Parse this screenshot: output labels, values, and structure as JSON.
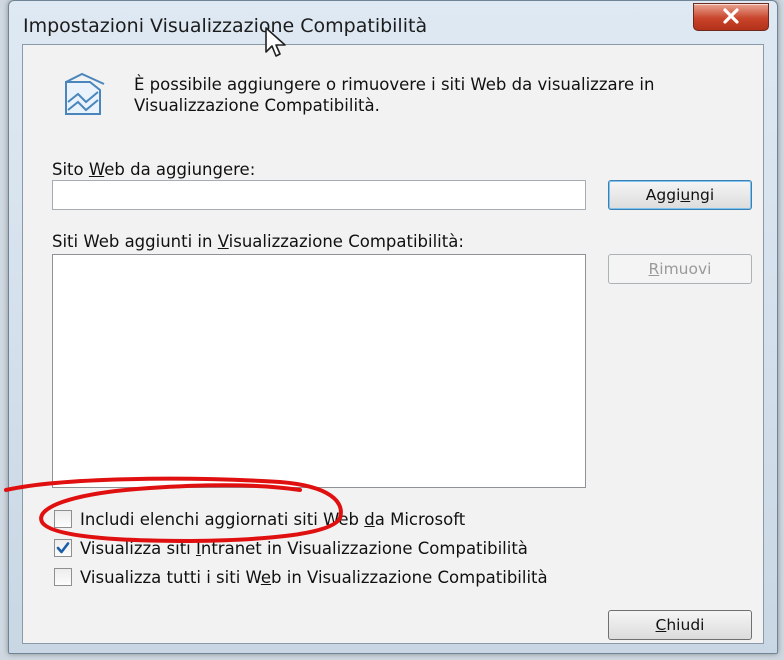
{
  "window": {
    "title": "Impostazioni Visualizzazione Compatibilità"
  },
  "intro": {
    "text": "È possibile aggiungere o rimuovere i siti Web da visualizzare in Visualizzazione Compatibilità."
  },
  "add_section": {
    "label_before": "Sito ",
    "label_accel": "W",
    "label_after": "eb da aggiungere:",
    "input_value": "",
    "add_button_before": "Aggi",
    "add_button_accel": "u",
    "add_button_after": "ngi"
  },
  "list_section": {
    "label_before": "Siti Web aggiunti in ",
    "label_accel": "V",
    "label_after": "isualizzazione Compatibilità:",
    "items": [],
    "remove_button_accel": "R",
    "remove_button_after": "imuovi"
  },
  "options": [
    {
      "before": "Includi elenchi aggiornati siti Web ",
      "accel": "d",
      "after": "a Microsoft",
      "checked": false
    },
    {
      "before": "Visualizza siti ",
      "accel": "I",
      "after": "ntranet in Visualizzazione Compatibilità",
      "checked": true
    },
    {
      "before": "Visualizza tutti i siti W",
      "accel": "e",
      "after": "b in Visualizzazione Compatibilità",
      "checked": false
    }
  ],
  "close_button": {
    "accel": "C",
    "after": "hiudi"
  },
  "colors": {
    "annotation": "#e01010",
    "close_red": "#c9452c",
    "check_blue": "#1a5ea8"
  }
}
